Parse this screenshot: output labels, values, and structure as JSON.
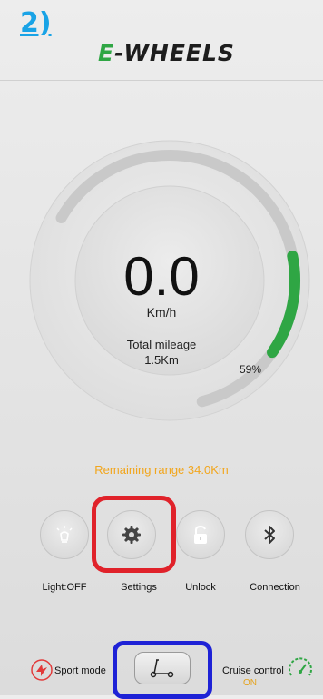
{
  "annotation": {
    "step_label": "2)"
  },
  "header": {
    "logo_prefix": "E",
    "logo_text": "-WHEELS"
  },
  "speedometer": {
    "speed": "0.0",
    "unit": "Km/h",
    "mileage_label": "Total mileage",
    "mileage_value": "1.5Km",
    "battery_percent_label": "59%",
    "battery_level": 0.59
  },
  "range": {
    "text": "Remaining range 34.0Km"
  },
  "controls": [
    {
      "label": "Light:OFF",
      "icon": "light-icon"
    },
    {
      "label": "Settings",
      "icon": "gear-icon"
    },
    {
      "label": "Unlock",
      "icon": "unlock-icon"
    },
    {
      "label": "Connection",
      "icon": "bluetooth-icon"
    }
  ],
  "bottom_bar": {
    "sport_mode_label": "Sport mode",
    "cruise_control_label": "Cruise control",
    "cruise_control_status": "ON"
  },
  "colors": {
    "accent_green": "#2fa644",
    "range_text": "#f2a61d",
    "highlight_red": "#e0222a",
    "highlight_blue": "#1e22d6"
  }
}
